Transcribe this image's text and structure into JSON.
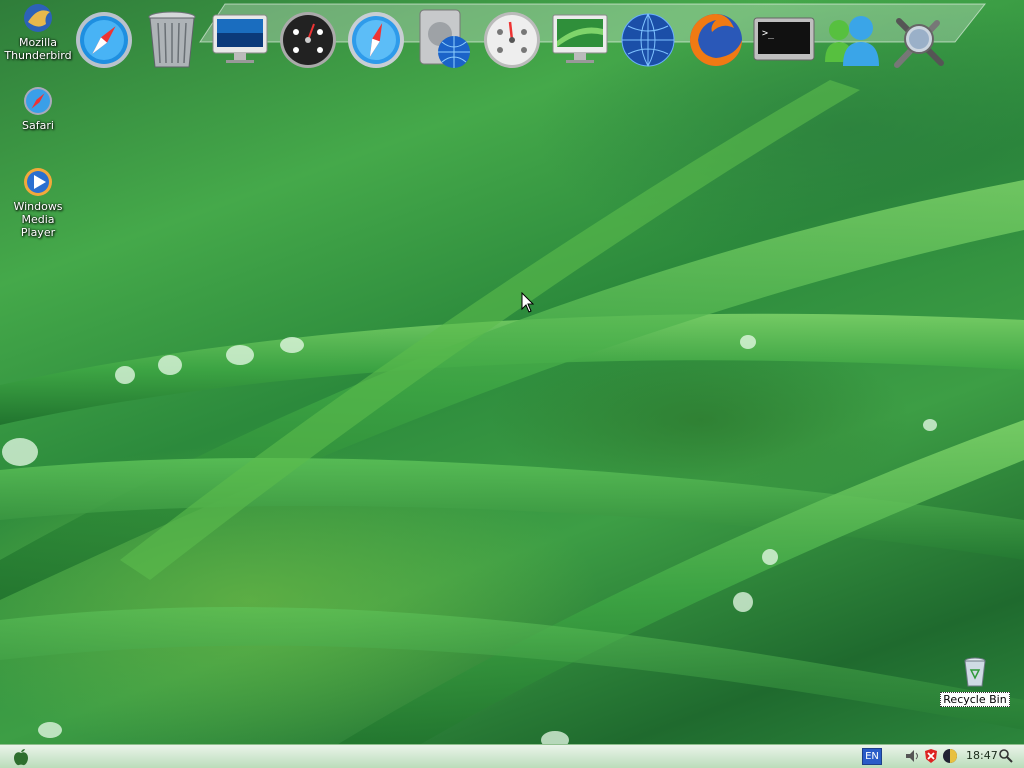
{
  "desktop": {
    "icons": [
      {
        "label": "Mozilla\nThunderbird",
        "icon": "thunderbird-icon"
      },
      {
        "label": "Safari",
        "icon": "safari-icon"
      },
      {
        "label": "Windows Media\nPlayer",
        "icon": "windows-media-player-icon"
      }
    ],
    "recycle_bin": {
      "label": "Recycle Bin",
      "icon": "recycle-bin-icon"
    }
  },
  "dock": {
    "items": [
      {
        "name": "safari",
        "icon": "compass-icon"
      },
      {
        "name": "trash",
        "icon": "trash-can-icon"
      },
      {
        "name": "imac",
        "icon": "monitor-icon"
      },
      {
        "name": "dashboard",
        "icon": "dashboard-icon"
      },
      {
        "name": "safari-2",
        "icon": "compass-icon"
      },
      {
        "name": "network-drive",
        "icon": "network-drive-icon"
      },
      {
        "name": "dashboard-2",
        "icon": "dashboard-icon"
      },
      {
        "name": "screen",
        "icon": "monitor-icon"
      },
      {
        "name": "thunderbird",
        "icon": "globe-icon"
      },
      {
        "name": "firefox",
        "icon": "firefox-icon"
      },
      {
        "name": "terminal",
        "icon": "terminal-icon"
      },
      {
        "name": "messenger",
        "icon": "messenger-icon"
      },
      {
        "name": "utilities",
        "icon": "tools-icon"
      }
    ]
  },
  "taskbar": {
    "start_icon": "apple-icon",
    "language": "EN",
    "tray_icons": [
      "volume-icon",
      "security-alert-icon",
      "network-icon",
      "search-icon"
    ],
    "clock": "18:47"
  },
  "colors": {
    "wallpaper": "#2f8a3c",
    "taskbar": "#c8e4c6",
    "accent": "#2a5cc8"
  }
}
